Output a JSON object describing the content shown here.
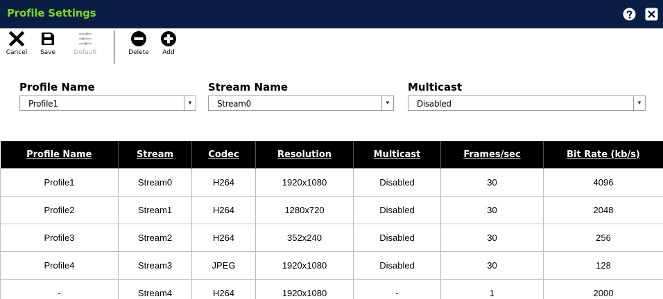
{
  "window": {
    "title": "Profile Settings"
  },
  "titlebar_icons": [
    "help-icon",
    "close-icon"
  ],
  "toolbar": {
    "cancel": "Cancel",
    "save": "Save",
    "default": "Default",
    "delete": "Delete",
    "add": "Add"
  },
  "fields": {
    "profile_name": {
      "label": "Profile Name",
      "value": "Profile1"
    },
    "stream_name": {
      "label": "Stream Name",
      "value": "Stream0"
    },
    "multicast": {
      "label": "Multicast",
      "value": "Disabled"
    }
  },
  "table": {
    "headers": [
      "Profile Name",
      "Stream",
      "Codec",
      "Resolution",
      "Multicast",
      "Frames/sec",
      "Bit Rate (kb/s)"
    ],
    "rows": [
      [
        "Profile1",
        "Stream0",
        "H264",
        "1920x1080",
        "Disabled",
        "30",
        "4096"
      ],
      [
        "Profile2",
        "Stream1",
        "H264",
        "1280x720",
        "Disabled",
        "30",
        "2048"
      ],
      [
        "Profile3",
        "Stream2",
        "H264",
        "352x240",
        "Disabled",
        "30",
        "256"
      ],
      [
        "Profile4",
        "Stream3",
        "JPEG",
        "1920x1080",
        "Disabled",
        "30",
        "128"
      ],
      [
        "-",
        "Stream4",
        "H264",
        "1920x1080",
        "-",
        "1",
        "2000"
      ]
    ]
  },
  "colors": {
    "titlebar_bg": "#0a1e45",
    "title_text": "#7ed321",
    "header_bg": "#000000"
  }
}
